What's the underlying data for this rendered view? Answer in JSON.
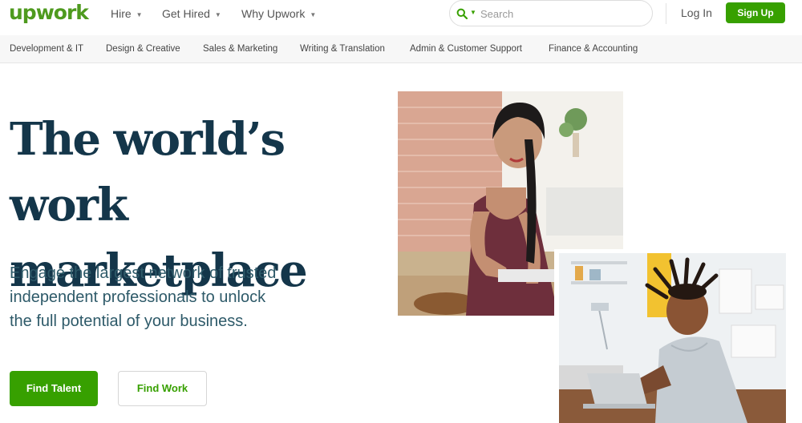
{
  "header": {
    "logo": "upwork",
    "nav": [
      {
        "label": "Hire"
      },
      {
        "label": "Get Hired"
      },
      {
        "label": "Why Upwork"
      }
    ],
    "search": {
      "placeholder": "Search",
      "value": ""
    },
    "login_label": "Log In",
    "signup_label": "Sign Up"
  },
  "categories": [
    "Development & IT",
    "Design & Creative",
    "Sales & Marketing",
    "Writing & Translation",
    "Admin & Customer Support",
    "Finance & Accounting"
  ],
  "hero": {
    "headline_line1": "The world’s work",
    "headline_line2": "marketplace",
    "subhead_line1": "Engage the largest network of trusted",
    "subhead_line2": "independent professionals to unlock",
    "subhead_line3": "the full potential of your business.",
    "find_talent_label": "Find Talent",
    "find_work_label": "Find Work"
  },
  "colors": {
    "brand_green": "#37a000",
    "headline_navy": "#14364a",
    "subhead_teal": "#2e5a69"
  },
  "icons": {
    "search": "search-icon",
    "caret": "chevron-down-icon"
  }
}
